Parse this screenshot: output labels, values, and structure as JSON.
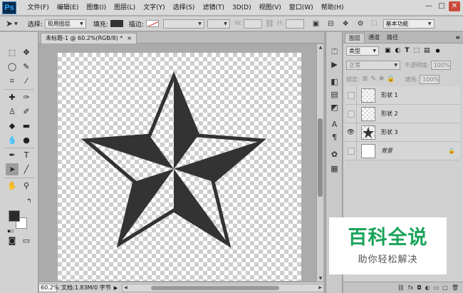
{
  "app": {
    "logo": "Ps"
  },
  "menu": [
    "文件(F)",
    "编辑(E)",
    "图像(I)",
    "图层(L)",
    "文字(Y)",
    "选择(S)",
    "滤镜(T)",
    "3D(D)",
    "视图(V)",
    "窗口(W)",
    "帮助(H)"
  ],
  "window_controls": {
    "minimize": "—",
    "maximize": "□",
    "close": "✕"
  },
  "options": {
    "select_label": "选择:",
    "select_value": "现用图层",
    "fill_label": "填充:",
    "stroke_label": "描边:",
    "w_label": "W:",
    "h_label": "H:",
    "workspace_value": "基本功能"
  },
  "document": {
    "tab_title": "未标题-1 @ 60.2%(RGB/8) *",
    "close_glyph": "×",
    "zoom": "60.2%",
    "info": "文档:1.83M/0 字节",
    "star_color": "#333333"
  },
  "panel": {
    "tabs": [
      "图层",
      "通道",
      "路径"
    ],
    "filter_kind": "类型",
    "blend_mode": "正常",
    "opacity_label": "不透明度:",
    "opacity_value": "100%",
    "lock_label": "锁定:",
    "fill_label": "填充:",
    "fill_value": "100%",
    "layers": [
      {
        "name": "形状 1",
        "visible": false,
        "thumb": "checker"
      },
      {
        "name": "形状 2",
        "visible": false,
        "thumb": "checker"
      },
      {
        "name": "形状 3",
        "visible": true,
        "thumb": "checker-star"
      },
      {
        "name": "背景",
        "visible": false,
        "thumb": "white",
        "locked": true
      }
    ]
  },
  "watermark": {
    "title": "百科全说",
    "subtitle": "助你轻松解决",
    "color": "#1aa35a"
  }
}
